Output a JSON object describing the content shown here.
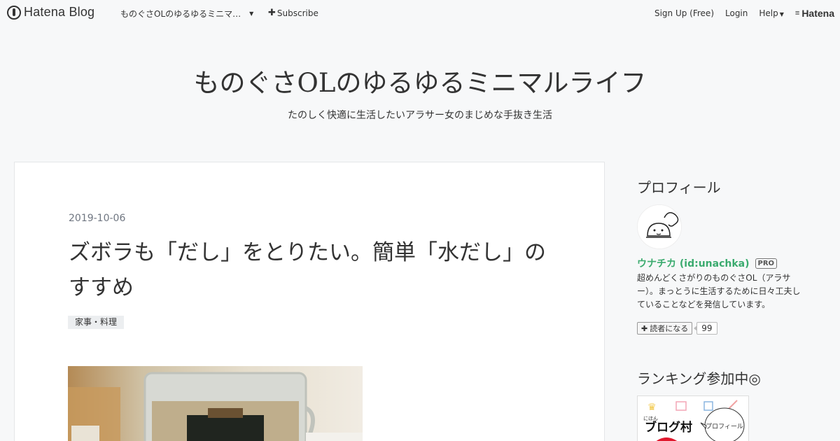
{
  "topbar": {
    "logo_text": "Hatena Blog",
    "blog_selector": "ものぐさOLのゆるゆるミニマ…",
    "subscribe_label": "Subscribe",
    "signup_label": "Sign Up (Free)",
    "login_label": "Login",
    "help_label": "Help",
    "brand_label": "Hatena"
  },
  "header": {
    "title": "ものぐさOLのゆるゆるミニマルライフ",
    "description": "たのしく快適に生活したいアラサー女のまじめな手抜き生活"
  },
  "article": {
    "date": "2019-10-06",
    "title": "ズボラも「だし」をとりたい。簡単「水だし」のすすめ",
    "category": "家事・料理"
  },
  "sidebar": {
    "profile": {
      "heading": "プロフィール",
      "name": "ウナチカ (id:unachka)",
      "badge": "PRO",
      "description": "超めんどくさがりのものぐさOL（アラサー）。まっとうに生活するために日々工夫していることなどを発信しています。",
      "reader_button": "読者になる",
      "reader_count": "99"
    },
    "ranking": {
      "heading": "ランキング参加中◎",
      "banner_small": "にほん",
      "banner_main": "ブログ村",
      "banner_bubble": "プロフィール"
    }
  },
  "colors": {
    "background": "#f7f8f9",
    "profile_name": "#3bab6f",
    "date_text": "#6f7681"
  }
}
